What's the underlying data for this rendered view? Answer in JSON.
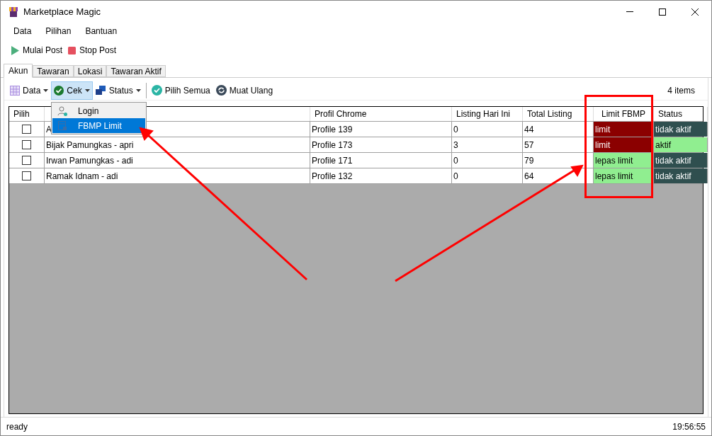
{
  "window": {
    "title": "Marketplace Magic"
  },
  "menu": [
    "Data",
    "Pilihan",
    "Bantuan"
  ],
  "actions": [
    {
      "kind": "play",
      "label": "Mulai Post"
    },
    {
      "kind": "stop",
      "label": "Stop Post"
    }
  ],
  "tabs": [
    {
      "label": "Akun",
      "selected": true
    },
    {
      "label": "Tawaran",
      "selected": false
    },
    {
      "label": "Lokasi",
      "selected": false
    },
    {
      "label": "Tawaran Aktif",
      "selected": false
    }
  ],
  "toolbar": [
    {
      "kind": "grid",
      "label": "Data",
      "dropdown": true,
      "selected": false
    },
    {
      "kind": "check",
      "label": "Cek",
      "dropdown": true,
      "selected": true
    },
    {
      "kind": "status",
      "label": "Status",
      "dropdown": true,
      "selected": false
    },
    {
      "kind": "checkall",
      "label": "Pilih Semua",
      "dropdown": false,
      "selected": false
    },
    {
      "kind": "reload",
      "label": "Muat Ulang",
      "dropdown": false,
      "selected": false
    }
  ],
  "item_count": "4 items",
  "dropdown_menu": [
    {
      "kind": "user",
      "label": "Login",
      "selected": false
    },
    {
      "kind": "lock",
      "label": "FBMP Limit",
      "selected": true
    }
  ],
  "table": {
    "columns": [
      "Pilih",
      "",
      "Profil Chrome",
      "Listing Hari Ini",
      "Total Listing",
      "Limit FBMP",
      "Status"
    ],
    "rows": [
      {
        "checked": false,
        "name": "A",
        "profile": "Profile 139",
        "today": "0",
        "total": "44",
        "limit": {
          "text": "limit",
          "color": "#8b0000"
        },
        "status": {
          "text": "tidak aktif",
          "color": "#2f4f4f"
        }
      },
      {
        "checked": false,
        "name": "Bijak Pamungkas - apri",
        "profile": "Profile 173",
        "today": "3",
        "total": "57",
        "limit": {
          "text": "limit",
          "color": "#8b0000"
        },
        "status": {
          "text": "aktif",
          "color": "#90ee90"
        }
      },
      {
        "checked": false,
        "name": "Irwan Pamungkas - adi",
        "profile": "Profile 171",
        "today": "0",
        "total": "79",
        "limit": {
          "text": "lepas limit",
          "color": "#90ee90"
        },
        "status": {
          "text": "tidak aktif",
          "color": "#2f4f4f"
        }
      },
      {
        "checked": false,
        "name": "Ramak Idnam - adi",
        "profile": "Profile 132",
        "today": "0",
        "total": "64",
        "limit": {
          "text": "lepas limit",
          "color": "#90ee90"
        },
        "status": {
          "text": "tidak aktif",
          "color": "#2f4f4f"
        }
      }
    ]
  },
  "status_bar": {
    "message": "ready",
    "time": "19:56:55"
  }
}
